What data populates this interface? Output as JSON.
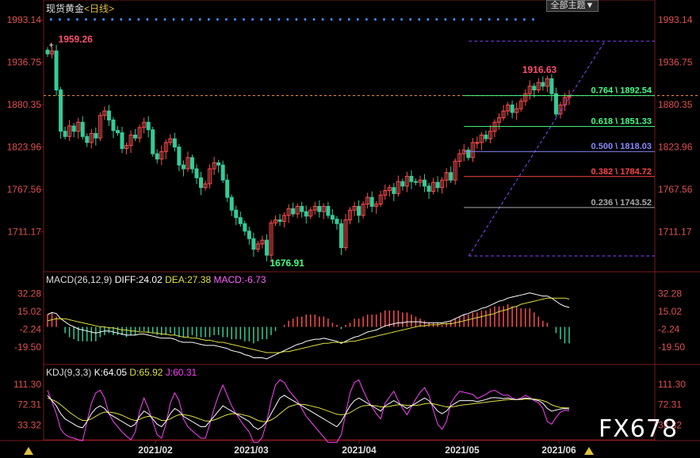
{
  "header": {
    "title": "现货黄金",
    "period": "<日线>",
    "theme_button": "全部主题▼"
  },
  "colors": {
    "up": "#ff4d4d",
    "down": "#33cc99",
    "bg": "#000000",
    "axis_text": "#e05050",
    "diff": "#ffffff",
    "dea": "#e0e040",
    "macd": "#ff60ff",
    "k": "#ffffff",
    "d": "#e0e040",
    "j": "#ff40ff"
  },
  "macd_header": {
    "name": "MACD(26,12,9)",
    "diff": "DIFF:24.02",
    "dea": "DEA:27.38",
    "macd": "MACD:-6.73"
  },
  "kdj_header": {
    "name": "KDJ(9,3,3)",
    "k": "K:64.05",
    "d": "D:65.92",
    "j": "J:60.31"
  },
  "watermark": "FX678",
  "chart_data": [
    {
      "type": "candlestick",
      "title": "现货黄金 <日线>",
      "y_ticks": [
        "1993.14",
        "1936.75",
        "1880.35",
        "1823.96",
        "1767.56",
        "1711.17"
      ],
      "y_tick_values": [
        1993.14,
        1936.75,
        1880.35,
        1823.96,
        1767.56,
        1711.17
      ],
      "ylim": [
        1660,
        2005
      ],
      "x_labels": [
        "2021/02",
        "2021/03",
        "2021/04",
        "2021/05",
        "2021/06"
      ],
      "annotations": {
        "high": "1959.26",
        "low": "1676.91",
        "recent_high": "1916.63"
      },
      "current_price": 1892.54,
      "fibonacci": [
        {
          "level": "0.764",
          "value": 1892.54,
          "label": "0.764 \\ 1892.54",
          "color": "#44ff88"
        },
        {
          "level": "0.618",
          "value": 1851.33,
          "label": "0.618 \\ 1851.33",
          "color": "#44ff88"
        },
        {
          "level": "0.500",
          "value": 1818.03,
          "label": "0.500 \\ 1818.03",
          "color": "#8888ff"
        },
        {
          "level": "0.382",
          "value": 1784.72,
          "label": "0.382 \\ 1784.72",
          "color": "#ff4444"
        },
        {
          "level": "0.236",
          "value": 1743.52,
          "label": "0.236 \\ 1743.52",
          "color": "#aaaaaa"
        }
      ],
      "closes": [
        1948,
        1952,
        1900,
        1845,
        1838,
        1852,
        1845,
        1857,
        1838,
        1830,
        1842,
        1836,
        1866,
        1872,
        1860,
        1846,
        1843,
        1822,
        1826,
        1840,
        1836,
        1850,
        1857,
        1847,
        1815,
        1808,
        1818,
        1830,
        1835,
        1824,
        1800,
        1795,
        1810,
        1795,
        1783,
        1770,
        1775,
        1795,
        1803,
        1800,
        1780,
        1757,
        1740,
        1730,
        1722,
        1712,
        1702,
        1688,
        1695,
        1700,
        1680,
        1723,
        1727,
        1725,
        1733,
        1742,
        1735,
        1745,
        1738,
        1732,
        1740,
        1745,
        1738,
        1745,
        1733,
        1728,
        1722,
        1690,
        1727,
        1740,
        1745,
        1733,
        1748,
        1757,
        1745,
        1748,
        1760,
        1766,
        1770,
        1762,
        1778,
        1772,
        1785,
        1778,
        1777,
        1780,
        1772,
        1765,
        1777,
        1770,
        1780,
        1790,
        1780,
        1805,
        1815,
        1820,
        1810,
        1830,
        1830,
        1840,
        1835,
        1845,
        1857,
        1863,
        1872,
        1880,
        1870,
        1875,
        1885,
        1895,
        1905,
        1900,
        1910,
        1905,
        1915,
        1895,
        1868,
        1880,
        1890,
        1892
      ],
      "volume_dots_note": "row of blue dots along top",
      "macd": {
        "y_ticks": [
          "32.28",
          "15.02",
          "-2.24",
          "-19.50"
        ],
        "y_tick_values": [
          32.28,
          15.02,
          -2.24,
          -19.5
        ],
        "ylim": [
          -35,
          42
        ],
        "diff": [
          12,
          14,
          13,
          8,
          5,
          2,
          0,
          -2,
          -3,
          -4,
          -5,
          -6,
          -5,
          -4,
          -4,
          -5,
          -6,
          -7,
          -8,
          -8,
          -8,
          -7,
          -7,
          -8,
          -9,
          -10,
          -11,
          -11,
          -11,
          -12,
          -14,
          -15,
          -15,
          -15,
          -16,
          -17,
          -18,
          -18,
          -18,
          -19,
          -20,
          -21,
          -23,
          -24,
          -25,
          -27,
          -28,
          -30,
          -30,
          -30,
          -31,
          -29,
          -27,
          -25,
          -23,
          -21,
          -19,
          -17,
          -16,
          -14,
          -13,
          -12,
          -12,
          -11,
          -12,
          -13,
          -14,
          -16,
          -14,
          -12,
          -10,
          -9,
          -7,
          -5,
          -4,
          -3,
          -1,
          1,
          2,
          3,
          4,
          4,
          5,
          5,
          5,
          5,
          4,
          4,
          4,
          4,
          4,
          5,
          6,
          8,
          10,
          12,
          13,
          15,
          16,
          18,
          19,
          21,
          23,
          25,
          26,
          28,
          29,
          30,
          31,
          32,
          33,
          32,
          31,
          30,
          30,
          28,
          25,
          22,
          20,
          19
        ],
        "dea": [
          6,
          7,
          8,
          8,
          8,
          7,
          6,
          5,
          4,
          3,
          2,
          1,
          0,
          0,
          -1,
          -1,
          -2,
          -3,
          -3,
          -4,
          -4,
          -5,
          -5,
          -5,
          -6,
          -6,
          -7,
          -7,
          -8,
          -8,
          -9,
          -10,
          -10,
          -11,
          -11,
          -12,
          -13,
          -13,
          -14,
          -15,
          -15,
          -16,
          -17,
          -18,
          -19,
          -20,
          -21,
          -22,
          -23,
          -24,
          -25,
          -25,
          -25,
          -25,
          -24,
          -24,
          -23,
          -22,
          -21,
          -20,
          -19,
          -18,
          -17,
          -16,
          -16,
          -15,
          -15,
          -15,
          -15,
          -14,
          -14,
          -13,
          -12,
          -11,
          -10,
          -9,
          -8,
          -7,
          -6,
          -5,
          -4,
          -3,
          -2,
          -1,
          0,
          1,
          1,
          2,
          2,
          2,
          3,
          3,
          3,
          4,
          5,
          6,
          7,
          8,
          9,
          10,
          11,
          12,
          13,
          15,
          16,
          17,
          19,
          20,
          22,
          23,
          24,
          25,
          26,
          27,
          28,
          28,
          28,
          28,
          28,
          27
        ]
      },
      "kdj": {
        "y_ticks": [
          "111.30",
          "72.31",
          "33.32"
        ],
        "y_tick_values": [
          111.3,
          72.31,
          33.32
        ],
        "ylim": [
          5,
          125
        ],
        "k": [
          90,
          80,
          70,
          55,
          45,
          40,
          35,
          30,
          28,
          40,
          55,
          65,
          70,
          65,
          55,
          50,
          45,
          40,
          35,
          30,
          35,
          50,
          60,
          55,
          45,
          35,
          30,
          40,
          55,
          65,
          60,
          50,
          45,
          40,
          35,
          30,
          30,
          40,
          50,
          60,
          70,
          65,
          60,
          55,
          50,
          45,
          40,
          30,
          25,
          30,
          40,
          55,
          70,
          85,
          90,
          85,
          80,
          75,
          70,
          65,
          60,
          55,
          50,
          45,
          40,
          35,
          30,
          40,
          55,
          70,
          80,
          85,
          80,
          75,
          70,
          65,
          60,
          70,
          75,
          80,
          75,
          70,
          65,
          70,
          75,
          80,
          85,
          80,
          70,
          60,
          55,
          60,
          70,
          75,
          80,
          80,
          80,
          80,
          78,
          80,
          82,
          85,
          86,
          85,
          84,
          85,
          83,
          82,
          83,
          85,
          84,
          82,
          80,
          75,
          65,
          60,
          62,
          64,
          65,
          64
        ],
        "d": [
          85,
          82,
          78,
          72,
          65,
          58,
          52,
          46,
          42,
          42,
          45,
          50,
          55,
          58,
          58,
          57,
          55,
          52,
          48,
          44,
          42,
          44,
          48,
          50,
          49,
          46,
          42,
          42,
          45,
          50,
          53,
          53,
          52,
          50,
          47,
          44,
          41,
          41,
          43,
          46,
          50,
          53,
          55,
          55,
          54,
          52,
          50,
          46,
          42,
          40,
          40,
          43,
          48,
          55,
          62,
          68,
          71,
          73,
          73,
          72,
          70,
          68,
          66,
          63,
          60,
          57,
          54,
          53,
          54,
          57,
          62,
          67,
          70,
          71,
          71,
          70,
          68,
          68,
          69,
          71,
          72,
          72,
          71,
          71,
          71,
          72,
          74,
          75,
          74,
          72,
          70,
          68,
          68,
          69,
          71,
          72,
          73,
          74,
          75,
          76,
          77,
          78,
          79,
          80,
          81,
          82,
          82,
          82,
          82,
          83,
          83,
          83,
          82,
          80,
          77,
          72,
          69,
          67,
          66,
          66
        ],
        "j": [
          100,
          78,
          55,
          25,
          15,
          10,
          8,
          5,
          3,
          40,
          75,
          95,
          100,
          85,
          55,
          40,
          30,
          20,
          12,
          5,
          20,
          60,
          85,
          65,
          40,
          15,
          8,
          35,
          75,
          95,
          80,
          45,
          30,
          22,
          15,
          8,
          8,
          35,
          65,
          90,
          110,
          90,
          70,
          55,
          42,
          30,
          20,
          0,
          0,
          10,
          40,
          80,
          110,
          120,
          115,
          100,
          90,
          80,
          65,
          50,
          40,
          30,
          20,
          10,
          0,
          0,
          0,
          15,
          55,
          95,
          115,
          120,
          100,
          82,
          68,
          55,
          45,
          75,
          87,
          98,
          80,
          65,
          53,
          68,
          83,
          96,
          105,
          90,
          62,
          35,
          25,
          40,
          75,
          88,
          98,
          96,
          94,
          92,
          84,
          88,
          92,
          98,
          100,
          95,
          90,
          91,
          85,
          82,
          85,
          90,
          86,
          80,
          76,
          65,
          40,
          35,
          48,
          58,
          62,
          60
        ]
      }
    }
  ]
}
